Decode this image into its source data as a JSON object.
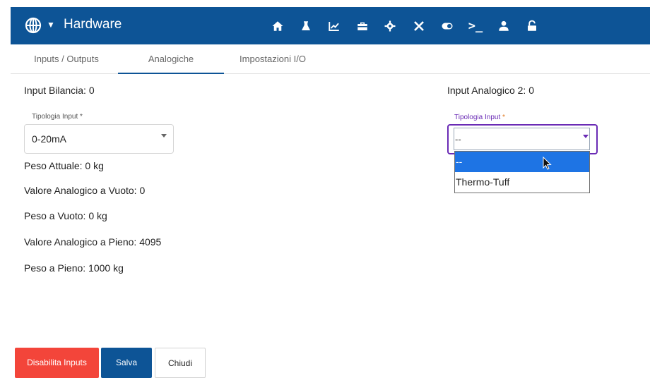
{
  "header": {
    "title": "Hardware",
    "bg_color": "#0d5496",
    "nav_icons": [
      "home-icon",
      "flask-icon",
      "chart-icon",
      "toolbox-icon",
      "gear-icon",
      "tools-icon",
      "toggle-icon",
      "terminal-icon",
      "user-icon",
      "unlock-icon"
    ],
    "terminal_text": ">_"
  },
  "tabs": [
    {
      "label": "Inputs / Outputs",
      "active": false
    },
    {
      "label": "Analogiche",
      "active": true
    },
    {
      "label": "Impostazioni I/O",
      "active": false
    }
  ],
  "left": {
    "input_title": "Input Bilancia: 0",
    "select_label": "Tipologia Input *",
    "select_value": "0-20mA",
    "fields": [
      "Peso Attuale: 0 kg",
      "Valore Analogico a Vuoto: 0",
      "Peso a Vuoto: 0 kg",
      "Valore Analogico a Pieno: 4095",
      "Peso a Pieno: 1000 kg"
    ]
  },
  "right": {
    "input_title": "Input Analogico 2: 0",
    "select_label": "Tipologia Input",
    "required_mark": "*",
    "select_value": "--",
    "options": [
      "--",
      "Thermo-Tuff"
    ],
    "highlighted_option": "--"
  },
  "buttons": {
    "disable": "Disabilita Inputs",
    "save": "Salva",
    "close": "Chiudi"
  },
  "colors": {
    "accent": "#0d5496",
    "danger": "#f3453a",
    "focus": "#6a2bb5",
    "highlight": "#1e74e4"
  }
}
